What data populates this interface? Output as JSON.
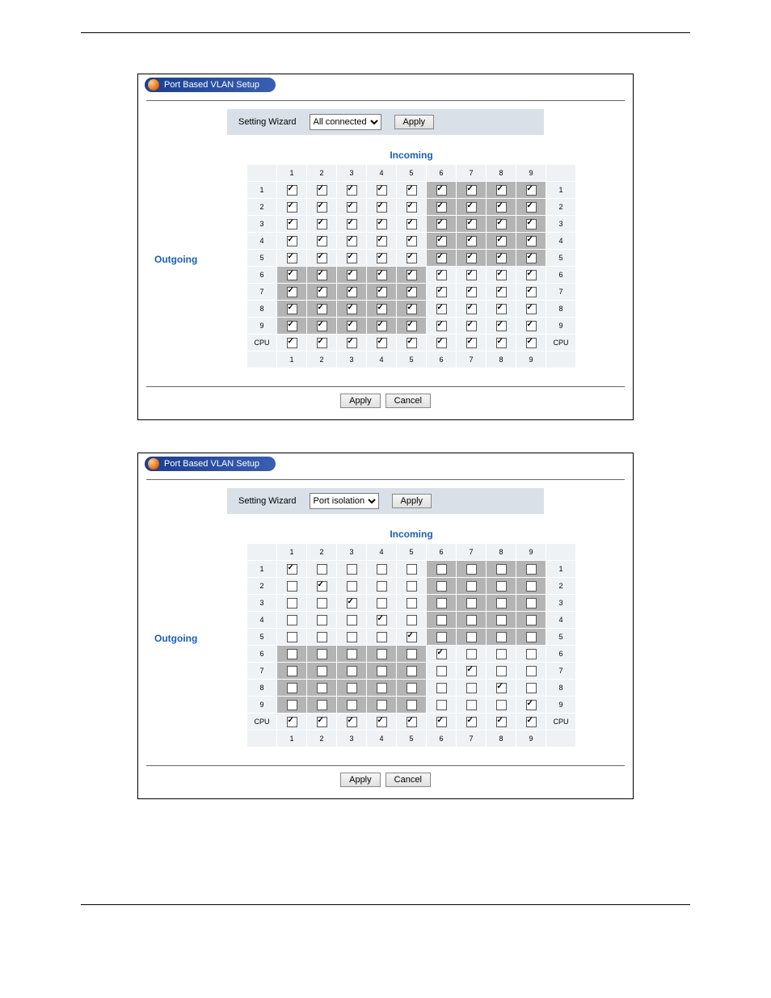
{
  "panels": [
    {
      "title": "Port Based VLAN Setup",
      "wizard_label": "Setting Wizard",
      "wizard_value": "All connected",
      "wizard_apply": "Apply",
      "incoming_label": "Incoming",
      "outgoing_label": "Outgoing",
      "col_headers": [
        "1",
        "2",
        "3",
        "4",
        "5",
        "6",
        "7",
        "8",
        "9"
      ],
      "row_headers": [
        "1",
        "2",
        "3",
        "4",
        "5",
        "6",
        "7",
        "8",
        "9",
        "CPU"
      ],
      "footer_headers": [
        "1",
        "2",
        "3",
        "4",
        "5",
        "6",
        "7",
        "8",
        "9"
      ],
      "matrix": [
        {
          "shaded_start": 5,
          "cells": [
            1,
            1,
            1,
            1,
            1,
            1,
            1,
            1,
            1
          ]
        },
        {
          "shaded_start": 5,
          "cells": [
            1,
            1,
            1,
            1,
            1,
            1,
            1,
            1,
            1
          ]
        },
        {
          "shaded_start": 5,
          "cells": [
            1,
            1,
            1,
            1,
            1,
            1,
            1,
            1,
            1
          ]
        },
        {
          "shaded_start": 5,
          "cells": [
            1,
            1,
            1,
            1,
            1,
            1,
            1,
            1,
            1
          ]
        },
        {
          "shaded_start": 5,
          "cells": [
            1,
            1,
            1,
            1,
            1,
            1,
            1,
            1,
            1
          ]
        },
        {
          "shaded_start": 0,
          "shaded_end": 5,
          "cells": [
            1,
            1,
            1,
            1,
            1,
            1,
            1,
            1,
            1
          ]
        },
        {
          "shaded_start": 0,
          "shaded_end": 5,
          "cells": [
            1,
            1,
            1,
            1,
            1,
            1,
            1,
            1,
            1
          ]
        },
        {
          "shaded_start": 0,
          "shaded_end": 5,
          "cells": [
            1,
            1,
            1,
            1,
            1,
            1,
            1,
            1,
            1
          ]
        },
        {
          "shaded_start": 0,
          "shaded_end": 5,
          "cells": [
            1,
            1,
            1,
            1,
            1,
            1,
            1,
            1,
            1
          ]
        },
        {
          "shaded_start": -1,
          "cells": [
            1,
            1,
            1,
            1,
            1,
            1,
            1,
            1,
            1
          ]
        }
      ],
      "apply_label": "Apply",
      "cancel_label": "Cancel"
    },
    {
      "title": "Port Based VLAN Setup",
      "wizard_label": "Setting Wizard",
      "wizard_value": "Port isolation",
      "wizard_apply": "Apply",
      "incoming_label": "Incoming",
      "outgoing_label": "Outgoing",
      "col_headers": [
        "1",
        "2",
        "3",
        "4",
        "5",
        "6",
        "7",
        "8",
        "9"
      ],
      "row_headers": [
        "1",
        "2",
        "3",
        "4",
        "5",
        "6",
        "7",
        "8",
        "9",
        "CPU"
      ],
      "footer_headers": [
        "1",
        "2",
        "3",
        "4",
        "5",
        "6",
        "7",
        "8",
        "9"
      ],
      "matrix": [
        {
          "shaded_start": 5,
          "cells": [
            1,
            0,
            0,
            0,
            0,
            0,
            0,
            0,
            0
          ]
        },
        {
          "shaded_start": 5,
          "cells": [
            0,
            1,
            0,
            0,
            0,
            0,
            0,
            0,
            0
          ]
        },
        {
          "shaded_start": 5,
          "cells": [
            0,
            0,
            1,
            0,
            0,
            0,
            0,
            0,
            0
          ]
        },
        {
          "shaded_start": 5,
          "cells": [
            0,
            0,
            0,
            1,
            0,
            0,
            0,
            0,
            0
          ]
        },
        {
          "shaded_start": 5,
          "cells": [
            0,
            0,
            0,
            0,
            1,
            0,
            0,
            0,
            0
          ]
        },
        {
          "shaded_start": 0,
          "shaded_end": 5,
          "cells": [
            0,
            0,
            0,
            0,
            0,
            1,
            0,
            0,
            0
          ]
        },
        {
          "shaded_start": 0,
          "shaded_end": 5,
          "cells": [
            0,
            0,
            0,
            0,
            0,
            0,
            1,
            0,
            0
          ]
        },
        {
          "shaded_start": 0,
          "shaded_end": 5,
          "cells": [
            0,
            0,
            0,
            0,
            0,
            0,
            0,
            1,
            0
          ]
        },
        {
          "shaded_start": 0,
          "shaded_end": 5,
          "cells": [
            0,
            0,
            0,
            0,
            0,
            0,
            0,
            0,
            1
          ]
        },
        {
          "shaded_start": -1,
          "cells": [
            1,
            1,
            1,
            1,
            1,
            1,
            1,
            1,
            1
          ]
        }
      ],
      "apply_label": "Apply",
      "cancel_label": "Cancel"
    }
  ]
}
